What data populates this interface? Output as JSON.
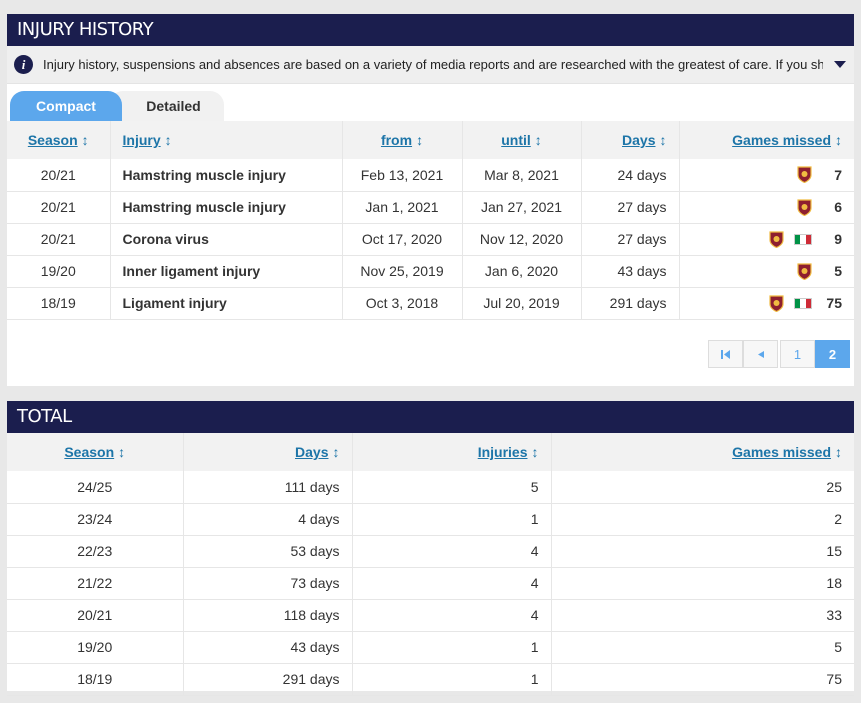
{
  "injury_history": {
    "title": "INJURY HISTORY",
    "info_text": "Injury history, suspensions and absences are based on a variety of media reports and are researched with the greatest of care. If you should n...",
    "tabs": [
      {
        "label": "Compact",
        "active": true
      },
      {
        "label": "Detailed",
        "active": false
      }
    ],
    "columns": {
      "season": "Season",
      "injury": "Injury",
      "from": "from",
      "until": "until",
      "days": "Days",
      "games_missed": "Games missed"
    },
    "rows": [
      {
        "season": "20/21",
        "injury": "Hamstring muscle injury",
        "from": "Feb 13, 2021",
        "until": "Mar 8, 2021",
        "days": "24 days",
        "games": "7",
        "icons": [
          "club"
        ]
      },
      {
        "season": "20/21",
        "injury": "Hamstring muscle injury",
        "from": "Jan 1, 2021",
        "until": "Jan 27, 2021",
        "days": "27 days",
        "games": "6",
        "icons": [
          "club"
        ]
      },
      {
        "season": "20/21",
        "injury": "Corona virus",
        "from": "Oct 17, 2020",
        "until": "Nov 12, 2020",
        "days": "27 days",
        "games": "9",
        "icons": [
          "club",
          "flag"
        ]
      },
      {
        "season": "19/20",
        "injury": "Inner ligament injury",
        "from": "Nov 25, 2019",
        "until": "Jan 6, 2020",
        "days": "43 days",
        "games": "5",
        "icons": [
          "club"
        ]
      },
      {
        "season": "18/19",
        "injury": "Ligament injury",
        "from": "Oct 3, 2018",
        "until": "Jul 20, 2019",
        "days": "291 days",
        "games": "75",
        "icons": [
          "club",
          "flag"
        ]
      }
    ],
    "pagination": {
      "first_icon": "first-page-icon",
      "prev_icon": "prev-page-icon",
      "pages": [
        "1",
        "2"
      ],
      "current": "2"
    }
  },
  "total": {
    "title": "TOTAL",
    "columns": {
      "season": "Season",
      "days": "Days",
      "injuries": "Injuries",
      "games_missed": "Games missed"
    },
    "rows": [
      {
        "season": "24/25",
        "days": "111 days",
        "injuries": "5",
        "games": "25"
      },
      {
        "season": "23/24",
        "days": "4 days",
        "injuries": "1",
        "games": "2"
      },
      {
        "season": "22/23",
        "days": "53 days",
        "injuries": "4",
        "games": "15"
      },
      {
        "season": "21/22",
        "days": "73 days",
        "injuries": "4",
        "games": "18"
      },
      {
        "season": "20/21",
        "days": "118 days",
        "injuries": "4",
        "games": "33"
      },
      {
        "season": "19/20",
        "days": "43 days",
        "injuries": "1",
        "games": "5"
      },
      {
        "season": "18/19",
        "days": "291 days",
        "injuries": "1",
        "games": "75"
      }
    ]
  },
  "colors": {
    "header_bg": "#1b1e4e",
    "accent": "#5ca7ec",
    "link": "#1d75a8",
    "club_red": "#8e1f2f",
    "club_gold": "#f0bc42",
    "flag_green": "#009246",
    "flag_red": "#ce2b37"
  }
}
